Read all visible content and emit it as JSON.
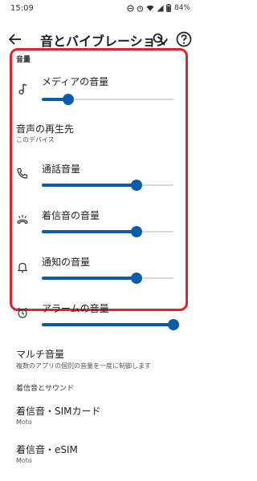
{
  "status_bar": {
    "time": "15:09",
    "battery": "84%",
    "icons": [
      "do-not-disturb-icon",
      "alarm-icon",
      "wifi-icon",
      "signal-icon",
      "battery-icon"
    ]
  },
  "app_bar": {
    "title": "音とバイブレーション",
    "back_icon": "arrow-left-icon",
    "search_icon": "search-icon",
    "help_icon": "help-icon"
  },
  "highlight_color": "#e8202a",
  "accent_color": "#0b5cab",
  "volume_section": {
    "header": "音量",
    "media": {
      "label": "メディアの音量",
      "icon": "music-note-icon",
      "level": 0.2
    },
    "output": {
      "title": "音声の再生先",
      "subtitle": "このデバイス"
    },
    "call": {
      "label": "通話音量",
      "icon": "phone-icon",
      "level": 0.72
    },
    "ring": {
      "label": "着信音の音量",
      "icon": "ring-muted-icon",
      "level": 0.72
    },
    "notification": {
      "label": "通知の音量",
      "icon": "bell-icon",
      "level": 0.72
    },
    "alarm": {
      "label": "アラームの音量",
      "icon": "alarm-clock-icon",
      "level": 1.0
    }
  },
  "multi_volume": {
    "title": "マルチ音量",
    "subtitle": "複数のアプリの個別の音量を一度に制御します"
  },
  "ringtone_section": {
    "header": "着信音とサウンド",
    "sim": {
      "title": "着信音・SIMカード",
      "subtitle": "Moto"
    },
    "esim": {
      "title": "着信音・eSIM",
      "subtitle": "Moto"
    }
  }
}
